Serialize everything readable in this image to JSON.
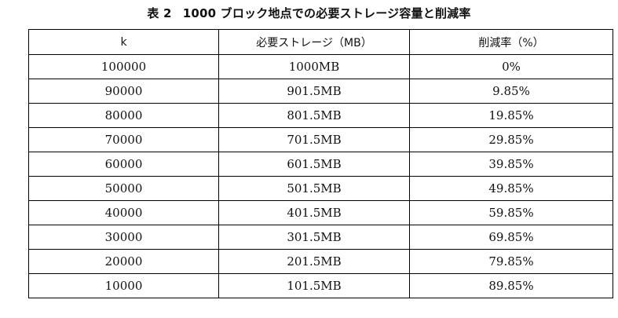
{
  "caption": {
    "label": "表 2",
    "text": "1000 ブロック地点での必要ストレージ容量と削減率"
  },
  "table": {
    "headers": [
      "k",
      "必要ストレージ（MB）",
      "削減率（%）"
    ],
    "rows": [
      [
        "100000",
        "1000MB",
        "0%"
      ],
      [
        "90000",
        "901.5MB",
        "9.85%"
      ],
      [
        "80000",
        "801.5MB",
        "19.85%"
      ],
      [
        "70000",
        "701.5MB",
        "29.85%"
      ],
      [
        "60000",
        "601.5MB",
        "39.85%"
      ],
      [
        "50000",
        "501.5MB",
        "49.85%"
      ],
      [
        "40000",
        "401.5MB",
        "59.85%"
      ],
      [
        "30000",
        "301.5MB",
        "69.85%"
      ],
      [
        "20000",
        "201.5MB",
        "79.85%"
      ],
      [
        "10000",
        "101.5MB",
        "89.85%"
      ]
    ]
  }
}
